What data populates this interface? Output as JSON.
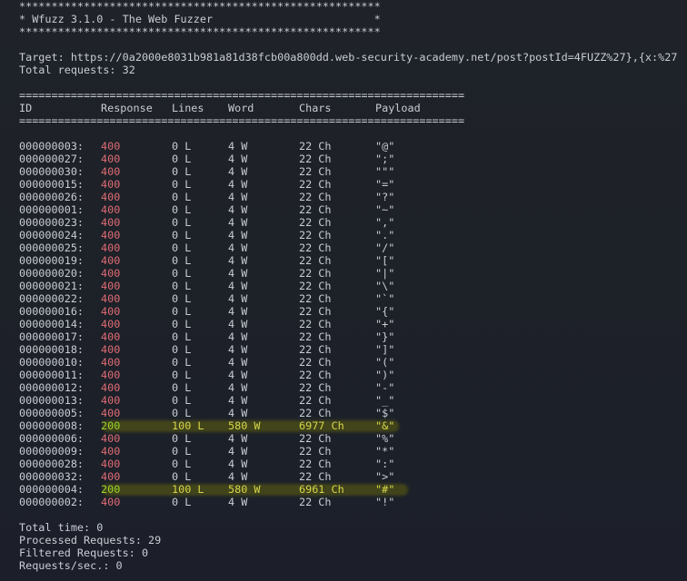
{
  "banner": {
    "stars": "********************************************************",
    "title": "* Wfuzz 3.1.0 - The Web Fuzzer                         *"
  },
  "target": "Target: https://0a2000e8031b981a81d38fcb00a800dd.web-security-academy.net/post?postId=4FUZZ%27},{x:%27",
  "total_requests": "Total requests: 32",
  "separator": "=====================================================================",
  "columns": [
    "ID",
    "Response",
    "Lines",
    "Word",
    "Chars",
    "Payload"
  ],
  "rows": [
    {
      "id": "000000003:",
      "response": "400",
      "lines": "0 L",
      "word": "4 W",
      "chars": "22 Ch",
      "payload": "\"@\""
    },
    {
      "id": "000000027:",
      "response": "400",
      "lines": "0 L",
      "word": "4 W",
      "chars": "22 Ch",
      "payload": "\";\""
    },
    {
      "id": "000000030:",
      "response": "400",
      "lines": "0 L",
      "word": "4 W",
      "chars": "22 Ch",
      "payload": "\"\"\""
    },
    {
      "id": "000000015:",
      "response": "400",
      "lines": "0 L",
      "word": "4 W",
      "chars": "22 Ch",
      "payload": "\"=\""
    },
    {
      "id": "000000026:",
      "response": "400",
      "lines": "0 L",
      "word": "4 W",
      "chars": "22 Ch",
      "payload": "\"?\""
    },
    {
      "id": "000000001:",
      "response": "400",
      "lines": "0 L",
      "word": "4 W",
      "chars": "22 Ch",
      "payload": "\"~\""
    },
    {
      "id": "000000023:",
      "response": "400",
      "lines": "0 L",
      "word": "4 W",
      "chars": "22 Ch",
      "payload": "\",\""
    },
    {
      "id": "000000024:",
      "response": "400",
      "lines": "0 L",
      "word": "4 W",
      "chars": "22 Ch",
      "payload": "\".\""
    },
    {
      "id": "000000025:",
      "response": "400",
      "lines": "0 L",
      "word": "4 W",
      "chars": "22 Ch",
      "payload": "\"/\""
    },
    {
      "id": "000000019:",
      "response": "400",
      "lines": "0 L",
      "word": "4 W",
      "chars": "22 Ch",
      "payload": "\"[\""
    },
    {
      "id": "000000020:",
      "response": "400",
      "lines": "0 L",
      "word": "4 W",
      "chars": "22 Ch",
      "payload": "\"|\""
    },
    {
      "id": "000000021:",
      "response": "400",
      "lines": "0 L",
      "word": "4 W",
      "chars": "22 Ch",
      "payload": "\"\\\""
    },
    {
      "id": "000000022:",
      "response": "400",
      "lines": "0 L",
      "word": "4 W",
      "chars": "22 Ch",
      "payload": "\"`\""
    },
    {
      "id": "000000016:",
      "response": "400",
      "lines": "0 L",
      "word": "4 W",
      "chars": "22 Ch",
      "payload": "\"{\""
    },
    {
      "id": "000000014:",
      "response": "400",
      "lines": "0 L",
      "word": "4 W",
      "chars": "22 Ch",
      "payload": "\"+\""
    },
    {
      "id": "000000017:",
      "response": "400",
      "lines": "0 L",
      "word": "4 W",
      "chars": "22 Ch",
      "payload": "\"}\""
    },
    {
      "id": "000000018:",
      "response": "400",
      "lines": "0 L",
      "word": "4 W",
      "chars": "22 Ch",
      "payload": "\"]\""
    },
    {
      "id": "000000010:",
      "response": "400",
      "lines": "0 L",
      "word": "4 W",
      "chars": "22 Ch",
      "payload": "\"(\""
    },
    {
      "id": "000000011:",
      "response": "400",
      "lines": "0 L",
      "word": "4 W",
      "chars": "22 Ch",
      "payload": "\")\""
    },
    {
      "id": "000000012:",
      "response": "400",
      "lines": "0 L",
      "word": "4 W",
      "chars": "22 Ch",
      "payload": "\"-\""
    },
    {
      "id": "000000013:",
      "response": "400",
      "lines": "0 L",
      "word": "4 W",
      "chars": "22 Ch",
      "payload": "\"_\""
    },
    {
      "id": "000000005:",
      "response": "400",
      "lines": "0 L",
      "word": "4 W",
      "chars": "22 Ch",
      "payload": "\"$\""
    },
    {
      "id": "000000008:",
      "response": "200",
      "lines": "100 L",
      "word": "580 W",
      "chars": "6977 Ch",
      "payload": "\"&\"",
      "hit": true
    },
    {
      "id": "000000006:",
      "response": "400",
      "lines": "0 L",
      "word": "4 W",
      "chars": "22 Ch",
      "payload": "\"%\""
    },
    {
      "id": "000000009:",
      "response": "400",
      "lines": "0 L",
      "word": "4 W",
      "chars": "22 Ch",
      "payload": "\"*\""
    },
    {
      "id": "000000028:",
      "response": "400",
      "lines": "0 L",
      "word": "4 W",
      "chars": "22 Ch",
      "payload": "\":\""
    },
    {
      "id": "000000032:",
      "response": "400",
      "lines": "0 L",
      "word": "4 W",
      "chars": "22 Ch",
      "payload": "\">\""
    },
    {
      "id": "000000004:",
      "response": "200",
      "lines": "100 L",
      "word": "580 W",
      "chars": "6961 Ch",
      "payload": "\"#\"",
      "hit": true
    },
    {
      "id": "000000002:",
      "response": "400",
      "lines": "0 L",
      "word": "4 W",
      "chars": "22 Ch",
      "payload": "\"!\""
    }
  ],
  "summary": {
    "total_time": "Total time: 0",
    "processed": "Processed Requests: 29",
    "filtered": "Filtered Requests: 0",
    "rate": "Requests/sec.: 0"
  },
  "colors": {
    "background": "#1f2329",
    "status_400": "#e06c75",
    "status_200": "#9bd42a",
    "hit_text": "#d6d64a",
    "hit_highlight": "#44471a"
  }
}
